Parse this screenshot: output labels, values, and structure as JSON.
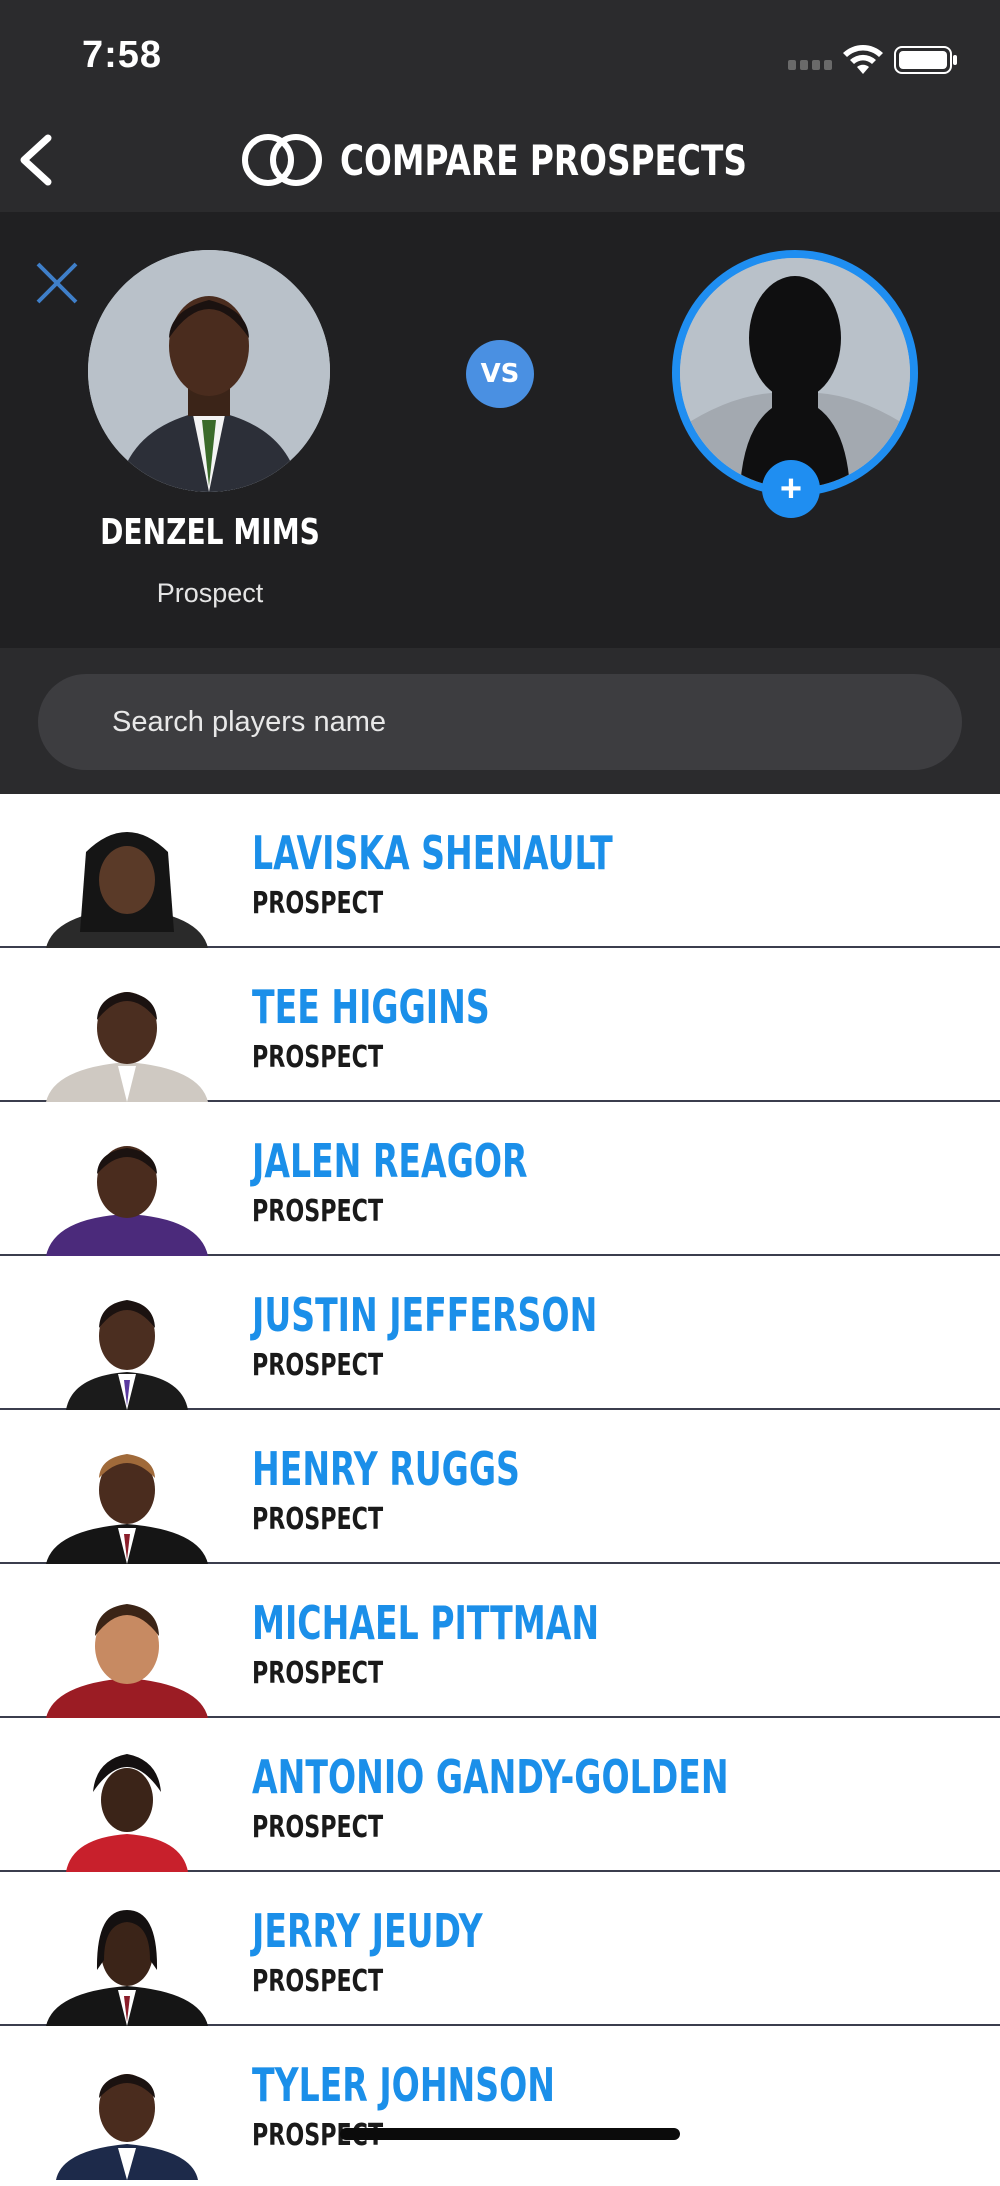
{
  "status": {
    "time": "7:58"
  },
  "header": {
    "title": "COMPARE PROSPECTS"
  },
  "compare": {
    "left_player": {
      "name": "DENZEL MIMS",
      "role": "Prospect"
    },
    "vs_label": "VS",
    "add_label": "+"
  },
  "search": {
    "placeholder": "Search players name",
    "value": ""
  },
  "players": [
    {
      "name": "LAVISKA SHENAULT",
      "role": "PROSPECT"
    },
    {
      "name": "TEE HIGGINS",
      "role": "PROSPECT"
    },
    {
      "name": "JALEN REAGOR",
      "role": "PROSPECT"
    },
    {
      "name": "JUSTIN JEFFERSON",
      "role": "PROSPECT"
    },
    {
      "name": "HENRY RUGGS",
      "role": "PROSPECT"
    },
    {
      "name": "MICHAEL PITTMAN",
      "role": "PROSPECT"
    },
    {
      "name": "ANTONIO GANDY-GOLDEN",
      "role": "PROSPECT"
    },
    {
      "name": "JERRY JEUDY",
      "role": "PROSPECT"
    },
    {
      "name": "TYLER JOHNSON",
      "role": "PROSPECT"
    }
  ],
  "colors": {
    "accent": "#1f8ef1",
    "name_blue": "#1b8fe9",
    "header_bg": "#2b2b2d",
    "compare_bg": "#202022"
  }
}
